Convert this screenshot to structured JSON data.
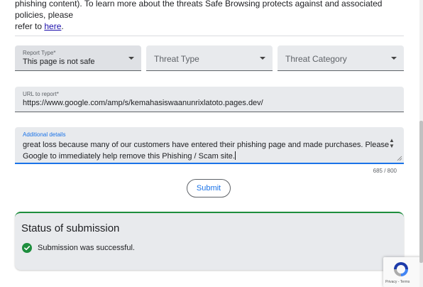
{
  "intro": {
    "line1": "phishing content). To learn more about the threats Safe Browsing protects against and associated policies, please",
    "line2": "refer to ",
    "link": "here",
    "line2_end": "."
  },
  "form": {
    "report_type": {
      "label": "Report Type*",
      "value": "This page is not safe"
    },
    "threat_type": {
      "placeholder": "Threat Type"
    },
    "threat_category": {
      "placeholder": "Threat Category"
    },
    "url": {
      "label": "URL to report*",
      "value": "https://www.google.com/amp/s/kemahasiswaanunrixlatoto.pages.dev/"
    },
    "details": {
      "label": "Additional details",
      "value_line1": "great loss because many of our customers have entered their phishing page and made purchases. Please",
      "value_line2": "Google to immediately help remove this Phishing / Scam site."
    },
    "counter": "685 / 800",
    "submit_label": "Submit"
  },
  "status": {
    "title": "Status of submission",
    "message": "Submission was successful.",
    "color": "#1e8e3e"
  },
  "recaptcha": {
    "links": "Privacy - Terms"
  }
}
